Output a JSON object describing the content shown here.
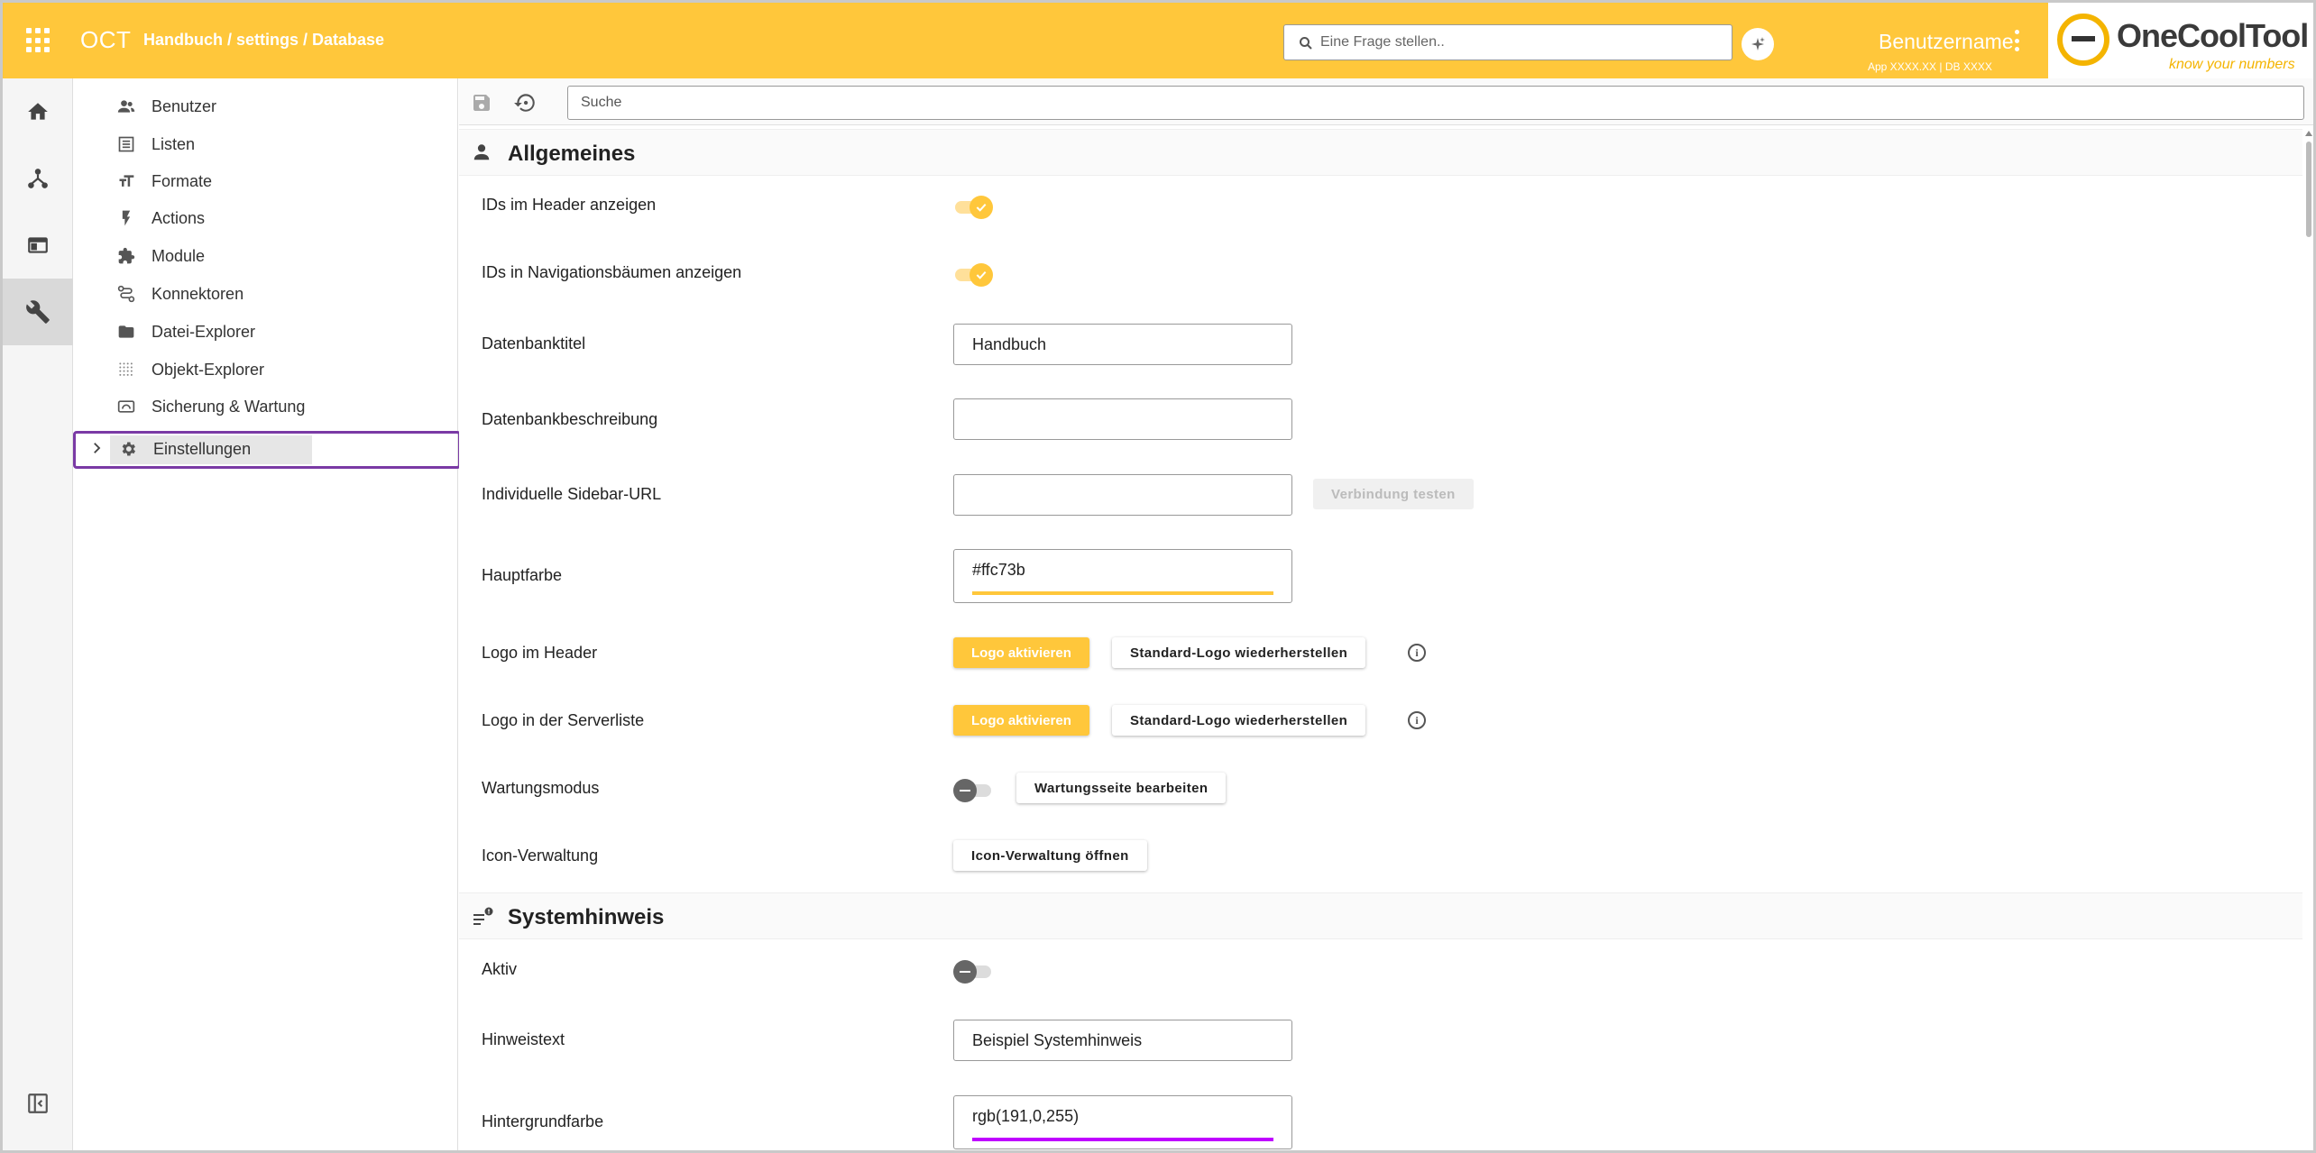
{
  "header": {
    "app_name": "OCT",
    "breadcrumb": "Handbuch / settings / Database",
    "ask_placeholder": "Eine Frage stellen..",
    "username": "Benutzername",
    "meta": "App XXXX.XX | DB XXXX",
    "logo_text": "OneCoolTool",
    "logo_tagline": "know your numbers"
  },
  "rail": {
    "items": [
      "home-icon",
      "hierarchy-icon",
      "dashboard-icon",
      "wrench-icon"
    ],
    "active": "wrench-icon"
  },
  "nav": {
    "items": [
      {
        "label": "Benutzer",
        "icon": "users-icon"
      },
      {
        "label": "Listen",
        "icon": "list-icon"
      },
      {
        "label": "Formate",
        "icon": "text-format-icon"
      },
      {
        "label": "Actions",
        "icon": "lightning-icon"
      },
      {
        "label": "Module",
        "icon": "puzzle-icon"
      },
      {
        "label": "Konnektoren",
        "icon": "connector-icon"
      },
      {
        "label": "Datei-Explorer",
        "icon": "folder-icon"
      },
      {
        "label": "Objekt-Explorer",
        "icon": "dots-grid-icon"
      },
      {
        "label": "Sicherung & Wartung",
        "icon": "backup-icon"
      },
      {
        "label": "Einstellungen",
        "icon": "gear-icon"
      }
    ],
    "selected": "Einstellungen"
  },
  "toolbar": {
    "search_placeholder": "Suche"
  },
  "sections": {
    "general": {
      "title": "Allgemeines",
      "ids_header_label": "IDs im Header anzeigen",
      "ids_header_on": true,
      "ids_nav_label": "IDs in Navigationsbäumen anzeigen",
      "ids_nav_on": true,
      "db_title_label": "Datenbanktitel",
      "db_title_value": "Handbuch",
      "db_desc_label": "Datenbankbeschreibung",
      "db_desc_value": "",
      "sidebar_url_label": "Individuelle Sidebar-URL",
      "sidebar_url_value": "",
      "test_connection": "Verbindung testen",
      "main_color_label": "Hauptfarbe",
      "main_color_value": "#ffc73b",
      "logo_header_label": "Logo im Header",
      "logo_activate": "Logo aktivieren",
      "logo_restore": "Standard-Logo wiederherstellen",
      "logo_serverlist_label": "Logo in der Serverliste",
      "maintenance_label": "Wartungsmodus",
      "maintenance_on": false,
      "maintenance_edit": "Wartungsseite bearbeiten",
      "icon_mgmt_label": "Icon-Verwaltung",
      "icon_mgmt_open": "Icon-Verwaltung öffnen"
    },
    "system_notice": {
      "title": "Systemhinweis",
      "active_label": "Aktiv",
      "active_on": false,
      "text_label": "Hinweistext",
      "text_value": "Beispiel Systemhinweis",
      "bg_color_label": "Hintergrundfarbe",
      "bg_color_value": "rgb(191,0,255)"
    }
  },
  "colors": {
    "accent": "#ffc73b",
    "selection_border": "#7a3aa5",
    "notice_bg": "#bf00ff"
  }
}
